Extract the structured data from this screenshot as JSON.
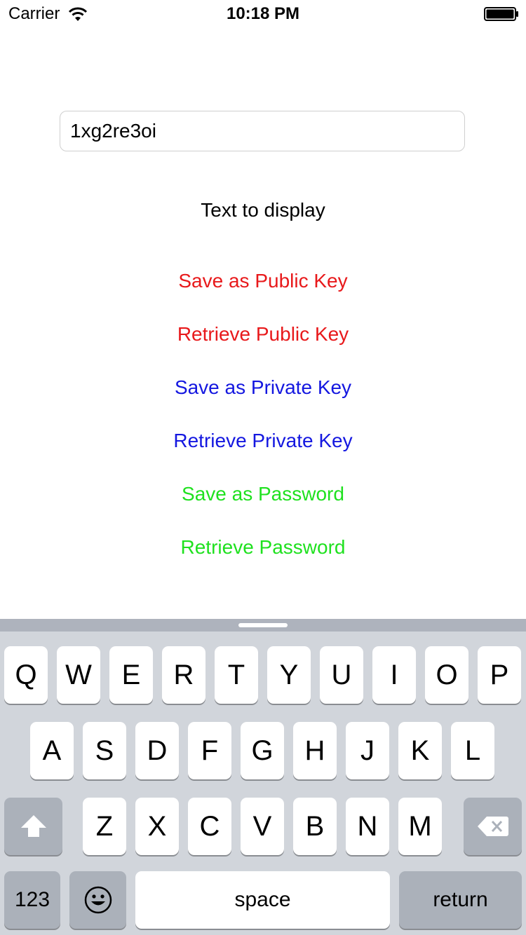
{
  "status_bar": {
    "carrier": "Carrier",
    "time": "10:18 PM"
  },
  "text_field": {
    "value": "1xg2re3oi"
  },
  "display_label": "Text to display",
  "buttons": [
    {
      "label": "Save as Public Key",
      "color": "#e8191b"
    },
    {
      "label": "Retrieve Public Key",
      "color": "#e8191b"
    },
    {
      "label": "Save as Private Key",
      "color": "#1417e0"
    },
    {
      "label": "Retrieve Private Key",
      "color": "#1417e0"
    },
    {
      "label": "Save as Password",
      "color": "#1fe11f"
    },
    {
      "label": "Retrieve Password",
      "color": "#1fe11f"
    }
  ],
  "keyboard": {
    "row1": [
      "Q",
      "W",
      "E",
      "R",
      "T",
      "Y",
      "U",
      "I",
      "O",
      "P"
    ],
    "row2": [
      "A",
      "S",
      "D",
      "F",
      "G",
      "H",
      "J",
      "K",
      "L"
    ],
    "row3": [
      "Z",
      "X",
      "C",
      "V",
      "B",
      "N",
      "M"
    ],
    "numbers_label": "123",
    "space_label": "space",
    "return_label": "return",
    "icons": [
      "shift-icon",
      "backspace-icon",
      "emoji-icon"
    ]
  }
}
